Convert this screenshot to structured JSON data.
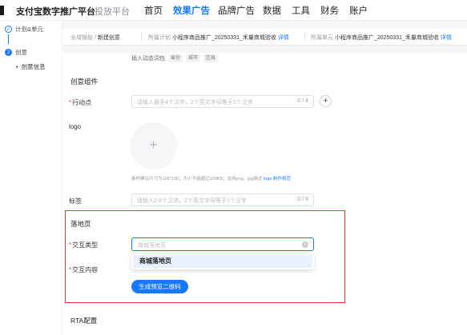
{
  "topnav": {
    "brand": "支付宝数字推广平台",
    "sub": "投放平台",
    "items": [
      "首页",
      "效果广告",
      "品牌广告",
      "数据",
      "工具",
      "财务",
      "账户"
    ],
    "active_index": 1
  },
  "sidebar": {
    "steps": [
      {
        "label": "计划&单元",
        "status": "done",
        "icon": "✓"
      },
      {
        "label": "创意",
        "status": "current",
        "icon": "2"
      }
    ],
    "sub_item": "创意信息"
  },
  "breadcrumb": {
    "path1": "全域搜投",
    "sep": " / ",
    "path2": "新建创意",
    "plan_key": "所属计划",
    "plan_val": "小程序商品推广_20250331_禾量商城验收",
    "plan_link": "详情",
    "unit_key": "所属单元",
    "unit_val": "小程序商品推广_20250331_禾量商城验收",
    "unit_link": "详情"
  },
  "form": {
    "dynamic_words_label": "插入动态词包",
    "dynamic_tags": [
      "省份",
      "城市",
      "区县"
    ],
    "section_creative": "创意组件",
    "action_point_label": "行动点",
    "action_point_placeholder": "请输入最多4个汉字，2个英文字母等于1个汉字",
    "action_point_count": "0 / 4",
    "logo_label": "logo",
    "upload_symbol": "+",
    "logo_hint": "素材建议尺寸为106*106；大小不能超过100KB；支持png、jpg格式",
    "logo_hint_link": "logo 制作规范",
    "tag_label": "标签",
    "tag_placeholder": "请输入2-8个汉字，2个英文字母等于1个汉字",
    "tag_count": "0 / 8",
    "section_landing": "落地页",
    "interaction_type_label": "交互类型",
    "interaction_type_placeholder": "商城落地页",
    "dropdown_option": "商城落地页",
    "interaction_content_label": "交互内容",
    "generate_button": "生成预览二维码",
    "section_rta": "RTA配置"
  },
  "colors": {
    "accent": "#1677ff",
    "highlight_box": "#e53935",
    "required": "#f53f3f"
  }
}
